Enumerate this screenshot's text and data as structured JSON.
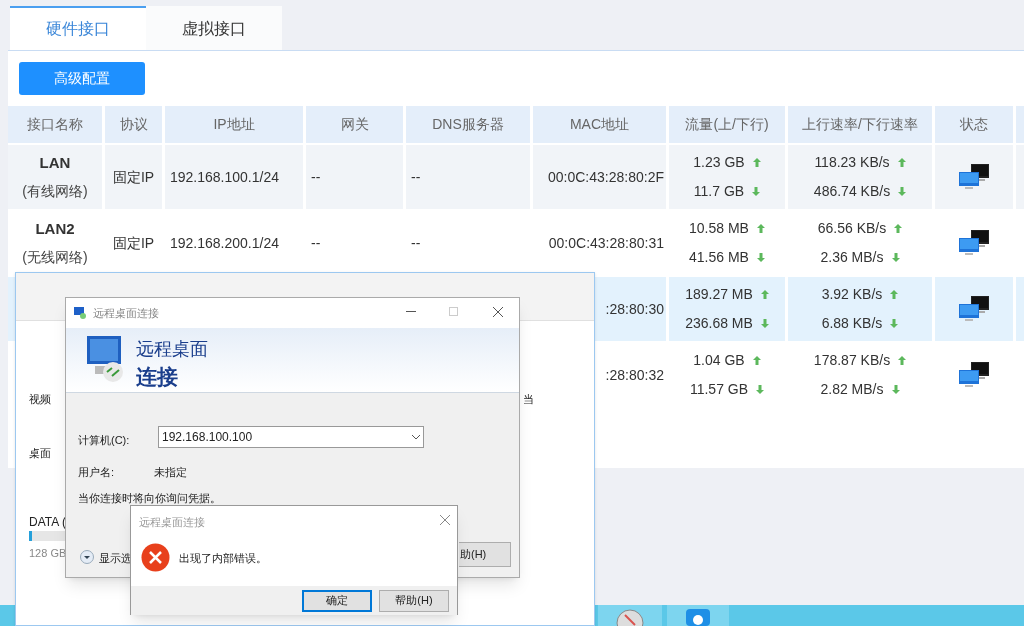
{
  "tabs": [
    {
      "label": "硬件接口",
      "selected": true
    },
    {
      "label": "虚拟接口",
      "selected": false
    }
  ],
  "toolbar": {
    "button": "高级配置"
  },
  "table": {
    "columns": [
      "接口名称",
      "协议",
      "IP地址",
      "网关",
      "DNS服务器",
      "MAC地址",
      "流量(上/下行)",
      "上行速率/下行速率",
      "状态"
    ],
    "rows": [
      {
        "name": "LAN",
        "type": "(有线网络)",
        "protocol": "固定IP",
        "ip": "192.168.100.1/24",
        "gateway": "--",
        "dns": "--",
        "mac": "00:0C:43:28:80:2F",
        "traffic_up": "1.23 GB",
        "traffic_down": "11.7 GB",
        "rate_up": "118.23 KB/s",
        "rate_down": "486.74 KB/s",
        "selected": false
      },
      {
        "name": "LAN2",
        "type": "(无线网络)",
        "protocol": "固定IP",
        "ip": "192.168.200.1/24",
        "gateway": "--",
        "dns": "--",
        "mac": "00:0C:43:28:80:31",
        "traffic_up": "10.58 MB",
        "traffic_down": "41.56 MB",
        "rate_up": "66.56 KB/s",
        "rate_down": "2.36 MB/s",
        "selected": false
      },
      {
        "mac": ":28:80:30",
        "traffic_up": "189.27 MB",
        "traffic_down": "236.68 MB",
        "rate_up": "3.92 KB/s",
        "rate_down": "6.88 KB/s",
        "selected": true
      },
      {
        "mac": ":28:80:32",
        "traffic_up": "1.04 GB",
        "traffic_down": "11.57 GB",
        "rate_up": "178.87 KB/s",
        "rate_down": "2.82 MB/s",
        "selected": false
      }
    ]
  },
  "explorer_window": {
    "items": [
      "视频",
      "桌面"
    ],
    "drive": {
      "label": "DATA (",
      "size": "128 GB",
      "level": 0.08
    },
    "cut_text": "当"
  },
  "rdp_dialog": {
    "title": "远程桌面连接",
    "heading_1": "远程桌面",
    "heading_2": "连接",
    "computer_label": "计算机(C):",
    "computer_value": "192.168.100.100",
    "user_label": "用户名:",
    "user_value": "未指定",
    "note": "当你连接时将向你询问凭据。",
    "options_label": "显示选",
    "help_button": "助(H)"
  },
  "error_dialog": {
    "title": "远程桌面连接",
    "message": "出现了内部错误。",
    "buttons": [
      {
        "label": "确定",
        "selected": true
      },
      {
        "label": "帮助(H)",
        "selected": false
      }
    ]
  }
}
